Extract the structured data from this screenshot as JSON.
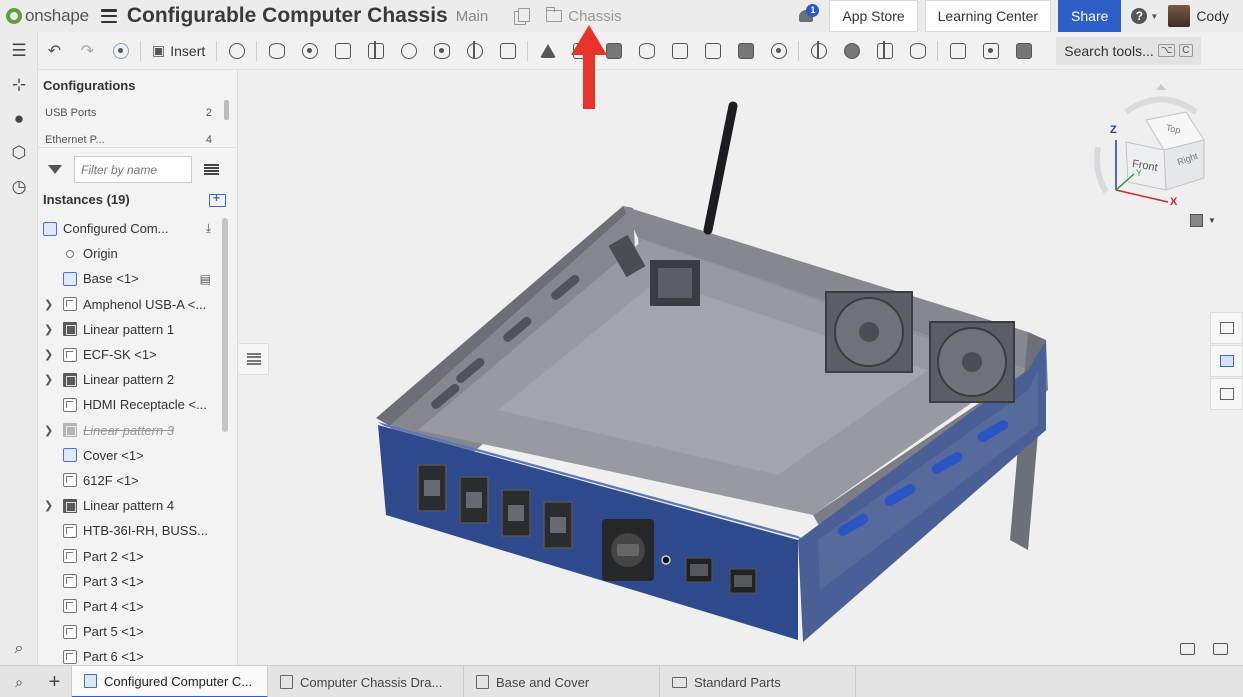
{
  "header": {
    "logo_text": "onshape",
    "document_title": "Configurable Computer Chassis",
    "branch": "Main",
    "folder_crumb": "Chassis",
    "notification_count": "1",
    "app_store": "App Store",
    "learning_center": "Learning Center",
    "share": "Share",
    "help": "?",
    "user_name": "Cody"
  },
  "toolbar": {
    "insert_label": "Insert",
    "search_tools": "Search tools...",
    "search_shortcut_1": "⌥",
    "search_shortcut_2": "C"
  },
  "configurations": {
    "heading": "Configurations",
    "rows": [
      {
        "name": "USB Ports",
        "value": "2"
      },
      {
        "name": "Ethernet P...",
        "value": "4"
      }
    ]
  },
  "filter": {
    "placeholder": "Filter by name"
  },
  "instances": {
    "heading": "Instances (19)",
    "items": [
      {
        "label": "Configured Com...",
        "icon": "assembly-icon",
        "expandable": false
      },
      {
        "label": "Origin",
        "icon": "origin-icon",
        "expandable": false
      },
      {
        "label": "Base <1>",
        "icon": "assembly-icon",
        "expandable": false
      },
      {
        "label": "Amphenol USB-A <...",
        "icon": "part-icon",
        "expandable": true
      },
      {
        "label": "Linear pattern 1",
        "icon": "pattern-icon",
        "expandable": true
      },
      {
        "label": "ECF-SK <1>",
        "icon": "part-icon",
        "expandable": true
      },
      {
        "label": "Linear pattern 2",
        "icon": "pattern-icon",
        "expandable": true
      },
      {
        "label": "HDMI Receptacle <...",
        "icon": "part-icon",
        "expandable": false
      },
      {
        "label": "Linear pattern 3",
        "icon": "pattern-icon",
        "expandable": true,
        "suppressed": true
      },
      {
        "label": "Cover <1>",
        "icon": "assembly-icon",
        "expandable": false
      },
      {
        "label": "612F <1>",
        "icon": "part-icon",
        "expandable": false
      },
      {
        "label": "Linear pattern 4",
        "icon": "pattern-icon",
        "expandable": true
      },
      {
        "label": "HTB-36I-RH, BUSS...",
        "icon": "part-icon",
        "expandable": false
      },
      {
        "label": "Part 2 <1>",
        "icon": "part-icon",
        "expandable": false
      },
      {
        "label": "Part 3 <1>",
        "icon": "part-icon",
        "expandable": false
      },
      {
        "label": "Part 4 <1>",
        "icon": "part-icon",
        "expandable": false
      },
      {
        "label": "Part 5 <1>",
        "icon": "part-icon",
        "expandable": false
      },
      {
        "label": "Part 6 <1>",
        "icon": "part-icon",
        "expandable": false
      }
    ]
  },
  "view_cube": {
    "top": "Top",
    "front": "Front",
    "right": "Right",
    "axis_x": "X",
    "axis_y": "Y",
    "axis_z": "Z"
  },
  "tabs": [
    {
      "label": "Configured Computer C...",
      "icon": "assembly-tab-icon",
      "active": true
    },
    {
      "label": "Computer Chassis Dra...",
      "icon": "drawing-tab-icon",
      "active": false
    },
    {
      "label": "Base and Cover",
      "icon": "partstudio-tab-icon",
      "active": false
    },
    {
      "label": "Standard Parts",
      "icon": "folder-tab-icon",
      "active": false
    }
  ],
  "colors": {
    "accent": "#2d5fc6",
    "chassis_blue": "#2f4a8c",
    "annotation_arrow": "#e8332a"
  }
}
